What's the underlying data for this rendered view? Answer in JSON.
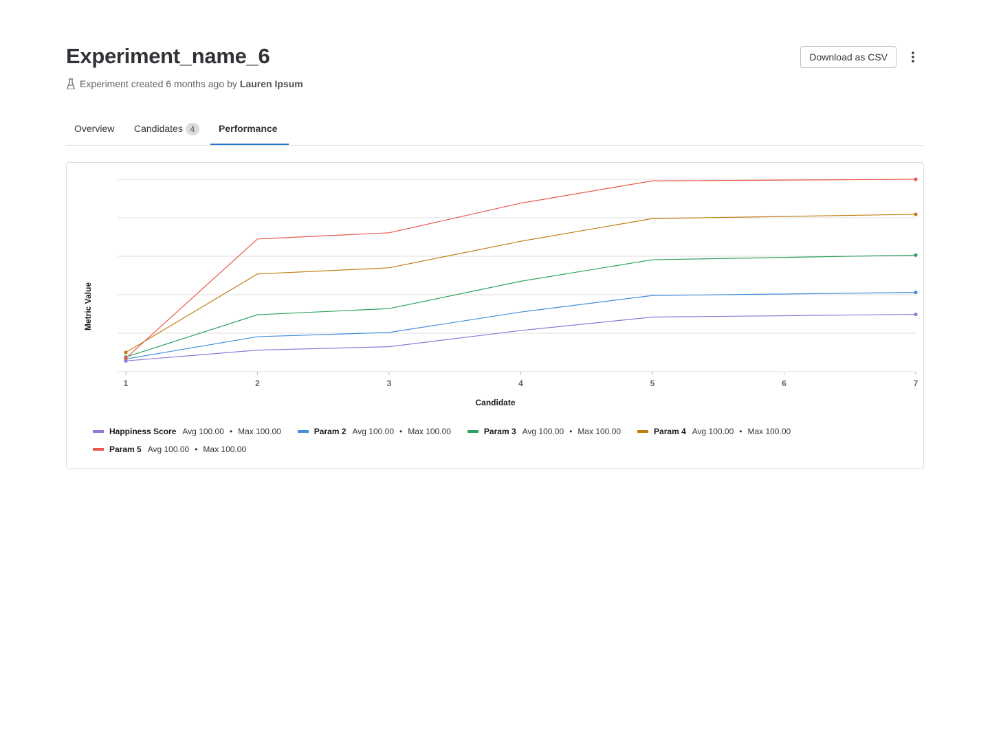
{
  "header": {
    "title": "Experiment_name_6",
    "created_text": "Experiment created 6 months ago",
    "by_text": "by",
    "author": "Lauren Ipsum",
    "download_label": "Download as CSV"
  },
  "tabs": [
    {
      "label": "Overview",
      "active": false
    },
    {
      "label": "Candidates",
      "count": "4",
      "active": false
    },
    {
      "label": "Performance",
      "active": true
    }
  ],
  "chart_data": {
    "type": "line",
    "xlabel": "Candidate",
    "ylabel": "Metric Value",
    "x": [
      1,
      2,
      3,
      4,
      5,
      6,
      7
    ],
    "ylim": [
      0,
      5
    ],
    "yticks_visible": false,
    "grid": true,
    "legend_position": "bottom",
    "series": [
      {
        "name": "Happiness Score",
        "color": "#9475db",
        "avg": "Avg 100.00",
        "max": "Max 100.00",
        "x": [
          1,
          2,
          3,
          4,
          5,
          7
        ],
        "values": [
          0.28,
          0.56,
          0.65,
          1.07,
          1.42,
          1.49
        ]
      },
      {
        "name": "Param 2",
        "color": "#428fdc",
        "avg": "Avg 100.00",
        "max": "Max 100.00",
        "x": [
          1,
          2,
          3,
          4,
          5,
          7
        ],
        "values": [
          0.33,
          0.91,
          1.02,
          1.55,
          1.98,
          2.06
        ]
      },
      {
        "name": "Param 3",
        "color": "#2da160",
        "avg": "Avg 100.00",
        "max": "Max 100.00",
        "x": [
          1,
          2,
          3,
          4,
          5,
          7
        ],
        "values": [
          0.38,
          1.48,
          1.64,
          2.35,
          2.91,
          3.03
        ]
      },
      {
        "name": "Param 4",
        "color": "#c17d10",
        "avg": "Avg 100.00",
        "max": "Max 100.00",
        "x": [
          1,
          2,
          3,
          4,
          5,
          7
        ],
        "values": [
          0.5,
          2.54,
          2.7,
          3.39,
          3.98,
          4.09
        ]
      },
      {
        "name": "Param 5",
        "color": "#e9574a",
        "avg": "Avg 100.00",
        "max": "Max 100.00",
        "x": [
          1,
          2,
          3,
          4,
          5,
          7
        ],
        "values": [
          0.35,
          3.45,
          3.61,
          4.38,
          4.96,
          5.0
        ]
      }
    ]
  }
}
